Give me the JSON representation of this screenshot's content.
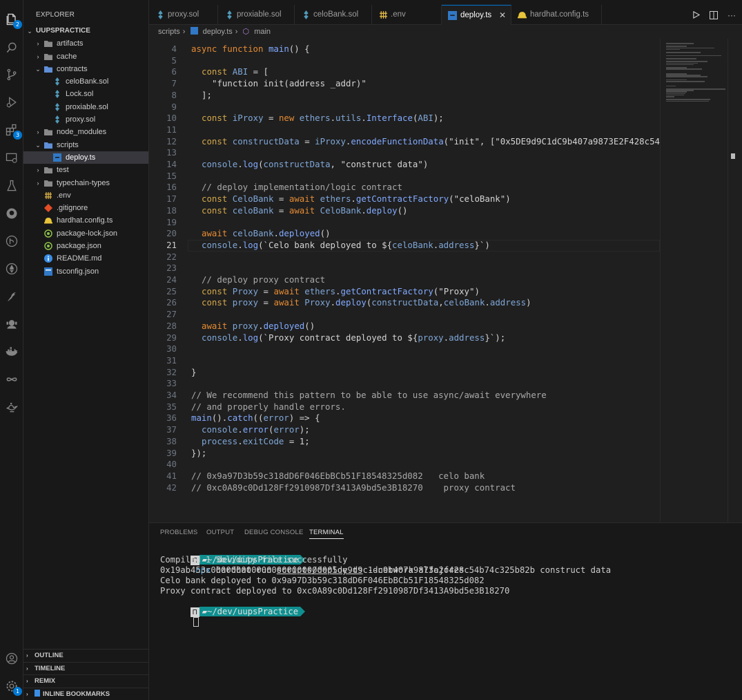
{
  "activity_bar": {
    "explorer_badge": "2",
    "extensions_badge": "3",
    "settings_badge": "1"
  },
  "sidebar": {
    "title": "EXPLORER",
    "root": "UUPSPRACTICE",
    "items": [
      {
        "label": "artifacts",
        "type": "folder-collapsed"
      },
      {
        "label": "cache",
        "type": "folder-collapsed"
      },
      {
        "label": "contracts",
        "type": "folder-expanded"
      },
      {
        "label": "celoBank.sol",
        "type": "sol"
      },
      {
        "label": "Lock.sol",
        "type": "sol"
      },
      {
        "label": "proxiable.sol",
        "type": "sol"
      },
      {
        "label": "proxy.sol",
        "type": "sol"
      },
      {
        "label": "node_modules",
        "type": "folder-collapsed"
      },
      {
        "label": "scripts",
        "type": "folder-expanded"
      },
      {
        "label": "deploy.ts",
        "type": "ts"
      },
      {
        "label": "test",
        "type": "folder-collapsed"
      },
      {
        "label": "typechain-types",
        "type": "folder-collapsed"
      },
      {
        "label": ".env",
        "type": "env"
      },
      {
        "label": ".gitignore",
        "type": "git"
      },
      {
        "label": "hardhat.config.ts",
        "type": "hardhat"
      },
      {
        "label": "package-lock.json",
        "type": "json"
      },
      {
        "label": "package.json",
        "type": "json"
      },
      {
        "label": "README.md",
        "type": "info"
      },
      {
        "label": "tsconfig.json",
        "type": "tsconfig"
      }
    ],
    "sections": [
      "OUTLINE",
      "TIMELINE",
      "REMIX",
      "INLINE BOOKMARKS"
    ]
  },
  "tabs": [
    {
      "label": "proxy.sol",
      "icon": "solidity-icon"
    },
    {
      "label": "proxiable.sol",
      "icon": "solidity-icon"
    },
    {
      "label": "celoBank.sol",
      "icon": "solidity-icon"
    },
    {
      "label": ".env",
      "icon": "env-icon"
    },
    {
      "label": "deploy.ts",
      "icon": "typescript-icon",
      "active": true,
      "close": "✕"
    },
    {
      "label": "hardhat.config.ts",
      "icon": "hardhat-icon"
    }
  ],
  "breadcrumb": [
    "scripts",
    "deploy.ts",
    "main"
  ],
  "editor": {
    "current_line": 21,
    "lines": [
      {
        "n": "4"
      },
      {
        "n": "5"
      },
      {
        "n": "6"
      },
      {
        "n": "7"
      },
      {
        "n": "8"
      },
      {
        "n": "9"
      },
      {
        "n": "10"
      },
      {
        "n": "11"
      },
      {
        "n": "12"
      },
      {
        "n": "13"
      },
      {
        "n": "14"
      },
      {
        "n": "15"
      },
      {
        "n": "16"
      },
      {
        "n": "17"
      },
      {
        "n": "18"
      },
      {
        "n": "19"
      },
      {
        "n": "20"
      },
      {
        "n": "21"
      },
      {
        "n": "22"
      },
      {
        "n": "23"
      },
      {
        "n": "24"
      },
      {
        "n": "25"
      },
      {
        "n": "26"
      },
      {
        "n": "27"
      },
      {
        "n": "28"
      },
      {
        "n": "29"
      },
      {
        "n": "30"
      },
      {
        "n": "31"
      },
      {
        "n": "32"
      },
      {
        "n": "33"
      },
      {
        "n": "34"
      },
      {
        "n": "35"
      },
      {
        "n": "36"
      },
      {
        "n": "37"
      },
      {
        "n": "38"
      },
      {
        "n": "39"
      },
      {
        "n": "40"
      },
      {
        "n": "41"
      },
      {
        "n": "42"
      }
    ],
    "code": {
      "l4": [
        "async",
        "function",
        "main",
        "() {"
      ],
      "l6": [
        "const",
        "ABI",
        " = ["
      ],
      "l7": "\"function init(address _addr)\"",
      "l8": "];",
      "l10": [
        "const",
        "iProxy",
        " = ",
        "new",
        "ethers",
        ".",
        "utils",
        ".",
        "Interface",
        "(",
        "ABI",
        ");"
      ],
      "l12": [
        "const",
        "constructData",
        " = ",
        "iProxy",
        ".",
        "encodeFunctionData",
        "(",
        "\"init\"",
        ", [",
        "\"0x5DE9d9C1dC9b407a9873E2F428c54"
      ],
      "l14": [
        "console",
        ".",
        "log",
        "(",
        "constructData",
        ", ",
        "\"construct data\"",
        ")"
      ],
      "l16": "// deploy implementation/logic contract",
      "l17": [
        "const",
        "CeloBank",
        " = ",
        "await",
        "ethers",
        ".",
        "getContractFactory",
        "(",
        "\"celoBank\"",
        ")"
      ],
      "l18": [
        "const",
        "celoBank",
        " = ",
        "await",
        "CeloBank",
        ".",
        "deploy",
        "()"
      ],
      "l20": [
        "await",
        "celoBank",
        ".",
        "deployed",
        "()"
      ],
      "l21": [
        "console",
        ".",
        "log",
        "(",
        "`Celo bank deployed to ${",
        "celoBank",
        ".",
        "address",
        "}`",
        ")"
      ],
      "l24": "// deploy proxy contract",
      "l25": [
        "const",
        "Proxy",
        " = ",
        "await",
        "ethers",
        ".",
        "getContractFactory",
        "(",
        "\"Proxy\"",
        ")"
      ],
      "l26": [
        "const",
        "proxy",
        " = ",
        "await",
        "Proxy",
        ".",
        "deploy",
        "(",
        "constructData",
        ",",
        "celoBank",
        ".",
        "address",
        ")"
      ],
      "l28": [
        "await",
        "proxy",
        ".",
        "deployed",
        "()"
      ],
      "l29": [
        "console",
        ".",
        "log",
        "(",
        "`Proxy contract deployed to ${",
        "proxy",
        ".",
        "address",
        "}`",
        ");"
      ],
      "l32": "}",
      "l34": "// We recommend this pattern to be able to use async/await everywhere",
      "l35": "// and properly handle errors.",
      "l36": [
        "main",
        "().",
        "catch",
        "((",
        "error",
        ") => {"
      ],
      "l37": [
        "console",
        ".",
        "error",
        "(",
        "error",
        ");"
      ],
      "l38": [
        "process",
        ".",
        "exitCode",
        " = ",
        "1",
        ";"
      ],
      "l39": "});",
      "l41": "// 0x9a97D3b59c318dD6F046EbBCb51F18548325d082   celo bank",
      "l42": "// 0xc0A89c0Dd128Ff2910987Df3413A9bd5e3B18270    proxy contract"
    }
  },
  "panel": {
    "tabs": [
      "PROBLEMS",
      "OUTPUT",
      "DEBUG CONSOLE",
      "TERMINAL"
    ],
    "active_tab": "TERMINAL",
    "prompt_dir": "~/dev/uupsPractice",
    "command": {
      "npx": "npx",
      "rest1": " hardhat run ",
      "path": "scripts/deploy.ts",
      "rest2": " --network alfajores"
    },
    "output": [
      "Compiled 1 Solidity file successfully",
      "0x19ab453c0000000000000000000000005de9d9c1dc9b407a9873e2f428c54b74c325b82b construct data",
      "Celo bank deployed to 0x9a97D3b59c318dD6F046EbBCb51F18548325d082",
      "Proxy contract deployed to 0xc0A89c0Dd128Ff2910987Df3413A9bd5e3B18270"
    ]
  }
}
